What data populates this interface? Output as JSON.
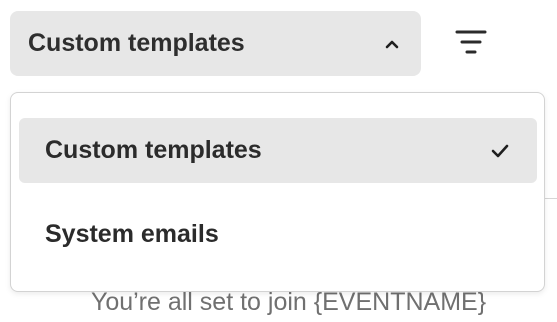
{
  "dropdown": {
    "selected_label": "Custom templates",
    "caret_icon": "chevron-up-icon",
    "expanded": true
  },
  "filter": {
    "icon": "filter-icon"
  },
  "menu": {
    "items": [
      {
        "label": "Custom templates",
        "selected": true,
        "check_icon": "check-icon"
      },
      {
        "label": "System emails",
        "selected": false
      }
    ]
  },
  "background": {
    "preview_text": "You’re all set to join {EVENTNAME}"
  },
  "colors": {
    "trigger_bg": "#e7e7e7",
    "selected_item_bg": "#e7e7e7",
    "text": "#2b2b2b",
    "muted_text": "#707070",
    "border": "#d3d3d3"
  }
}
